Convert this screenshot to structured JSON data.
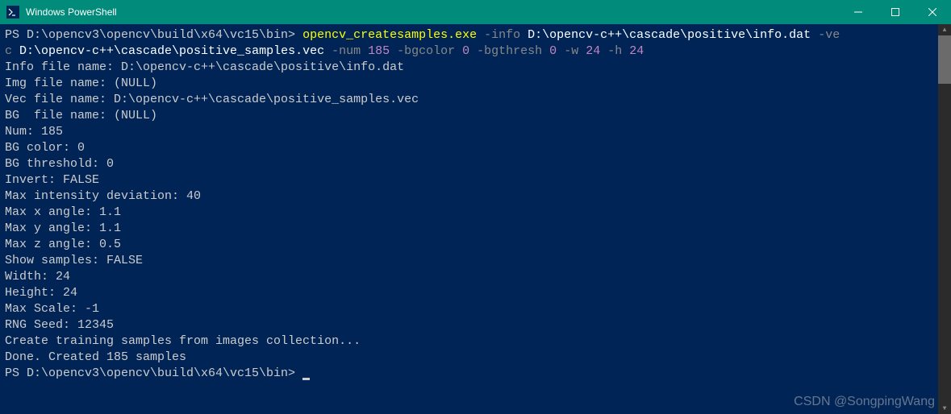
{
  "titlebar": {
    "title": "Windows PowerShell",
    "icon_label": "PS"
  },
  "command": {
    "prompt1": "PS D:\\opencv3\\opencv\\build\\x64\\vc15\\bin> ",
    "exe": "opencv_createsamples.exe",
    "flag_info": " -info ",
    "val_info": "D:\\opencv-c++\\cascade\\positive\\info.dat",
    "flag_vec": " -ve\nc ",
    "val_vec": "D:\\opencv-c++\\cascade\\positive_samples.vec",
    "flag_num": " -num ",
    "val_num": "185",
    "flag_bgcolor": " -bgcolor ",
    "val_bgcolor": "0",
    "flag_bgthresh": " -bgthresh ",
    "val_bgthresh": "0",
    "flag_w": " -w ",
    "val_w": "24",
    "flag_h": " -h ",
    "val_h": "24"
  },
  "output": {
    "l1": "Info file name: D:\\opencv-c++\\cascade\\positive\\info.dat",
    "l2": "Img file name: (NULL)",
    "l3": "Vec file name: D:\\opencv-c++\\cascade\\positive_samples.vec",
    "l4": "BG  file name: (NULL)",
    "l5": "Num: 185",
    "l6": "BG color: 0",
    "l7": "BG threshold: 0",
    "l8": "Invert: FALSE",
    "l9": "Max intensity deviation: 40",
    "l10": "Max x angle: 1.1",
    "l11": "Max y angle: 1.1",
    "l12": "Max z angle: 0.5",
    "l13": "Show samples: FALSE",
    "l14": "Width: 24",
    "l15": "Height: 24",
    "l16": "Max Scale: -1",
    "l17": "RNG Seed: 12345",
    "l18": "Create training samples from images collection...",
    "l19": "Done. Created 185 samples"
  },
  "prompt2": "PS D:\\opencv3\\opencv\\build\\x64\\vc15\\bin> ",
  "watermark": "CSDN @SongpingWang"
}
